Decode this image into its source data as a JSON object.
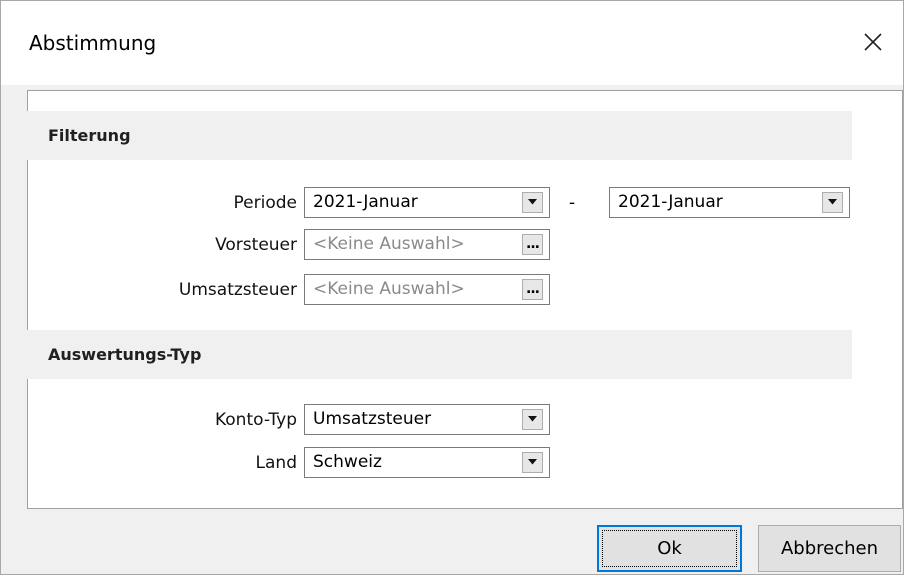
{
  "window": {
    "title": "Abstimmung"
  },
  "icons": {
    "close": "close-icon",
    "dropdown": "chevron-down-icon",
    "ellipsis": "ellipsis-icon"
  },
  "filter": {
    "heading": "Filterung",
    "periode": {
      "label": "Periode",
      "from": "2021-Januar",
      "separator": "-",
      "to": "2021-Januar"
    },
    "vorsteuer": {
      "label": "Vorsteuer",
      "value": "<Keine Auswahl>",
      "button": "..."
    },
    "umsatzsteuer": {
      "label": "Umsatzsteuer",
      "value": "<Keine Auswahl>",
      "button": "..."
    }
  },
  "auswertung": {
    "heading": "Auswertungs-Typ",
    "konto_typ": {
      "label": "Konto-Typ",
      "value": "Umsatzsteuer"
    },
    "land": {
      "label": "Land",
      "value": "Schweiz"
    }
  },
  "buttons": {
    "ok": "Ok",
    "cancel": "Abbrechen"
  },
  "colors": {
    "accent": "#0078d7",
    "section_bg": "#f0f0f0",
    "placeholder_text": "#8a8a8a"
  }
}
